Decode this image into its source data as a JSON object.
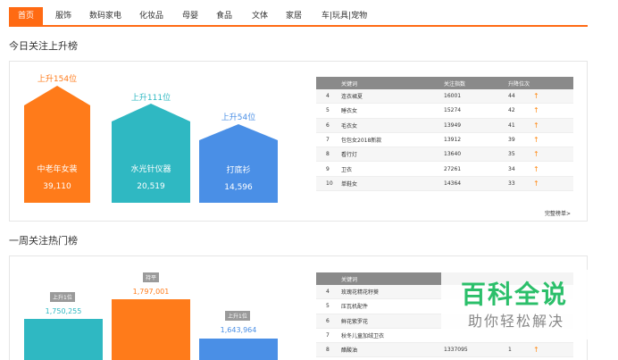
{
  "nav": {
    "items": [
      "首页",
      "服饰",
      "数码家电",
      "化妆品",
      "母婴",
      "食品",
      "文体",
      "家居",
      "车|玩具|宠物"
    ]
  },
  "today": {
    "title": "今日关注上升榜",
    "top3": [
      {
        "rank_up": "上升154位",
        "label": "中老年女装",
        "value": "39,110",
        "color": "#ff7b1a"
      },
      {
        "rank_up": "上升111位",
        "label": "水光针仪器",
        "value": "20,519",
        "color": "#2fb8c2"
      },
      {
        "rank_up": "上升54位",
        "label": "打底衫",
        "value": "14,596",
        "color": "#4a8fe6"
      }
    ],
    "table": {
      "headers": [
        "关键词",
        "关注指数",
        "升降位次"
      ],
      "rows": [
        {
          "rank": "4",
          "keyword": "连衣裙夏",
          "index": "16001",
          "change": "44"
        },
        {
          "rank": "5",
          "keyword": "睡衣女",
          "index": "15274",
          "change": "42"
        },
        {
          "rank": "6",
          "keyword": "毛衣女",
          "index": "13949",
          "change": "41"
        },
        {
          "rank": "7",
          "keyword": "包包女2018新款",
          "index": "13912",
          "change": "39"
        },
        {
          "rank": "8",
          "keyword": "看行灯",
          "index": "13640",
          "change": "35"
        },
        {
          "rank": "9",
          "keyword": "卫衣",
          "index": "27261",
          "change": "34"
        },
        {
          "rank": "10",
          "keyword": "单鞋女",
          "index": "14364",
          "change": "33"
        }
      ],
      "more": "完整榜单>"
    }
  },
  "week": {
    "title": "一周关注热门榜",
    "top3": [
      {
        "badge": "上升1位",
        "value": "1,750,255",
        "label": "",
        "color": "#2fb8c2",
        "value_color": "#2fb8c2"
      },
      {
        "badge": "持平",
        "value": "1,797,001",
        "label": "",
        "color": "#ff7b1a",
        "value_color": "#ff7b1a"
      },
      {
        "badge": "上升1位",
        "value": "1,643,964",
        "label": "",
        "color": "#4a8fe6",
        "value_color": "#4a8fe6"
      }
    ],
    "table": {
      "headers": [
        "关键词",
        "",
        ""
      ],
      "rows": [
        {
          "rank": "4",
          "keyword": "玫瑰花精花籽葵",
          "index": "",
          "change": ""
        },
        {
          "rank": "5",
          "keyword": "压瓦机配件",
          "index": "",
          "change": ""
        },
        {
          "rank": "6",
          "keyword": "鲜花紫罗花",
          "index": "",
          "change": ""
        },
        {
          "rank": "7",
          "keyword": "秋冬儿童加绒卫衣",
          "index": "",
          "change": ""
        },
        {
          "rank": "8",
          "keyword": "醋酸油",
          "index": "1337095",
          "change": "1"
        }
      ]
    }
  },
  "watermark": {
    "title": "百科全说",
    "subtitle": "助你轻松解决"
  },
  "colors": {
    "accent": "#ff6a13",
    "orange": "#ff7b1a",
    "teal": "#2fb8c2",
    "blue": "#4a8fe6"
  }
}
